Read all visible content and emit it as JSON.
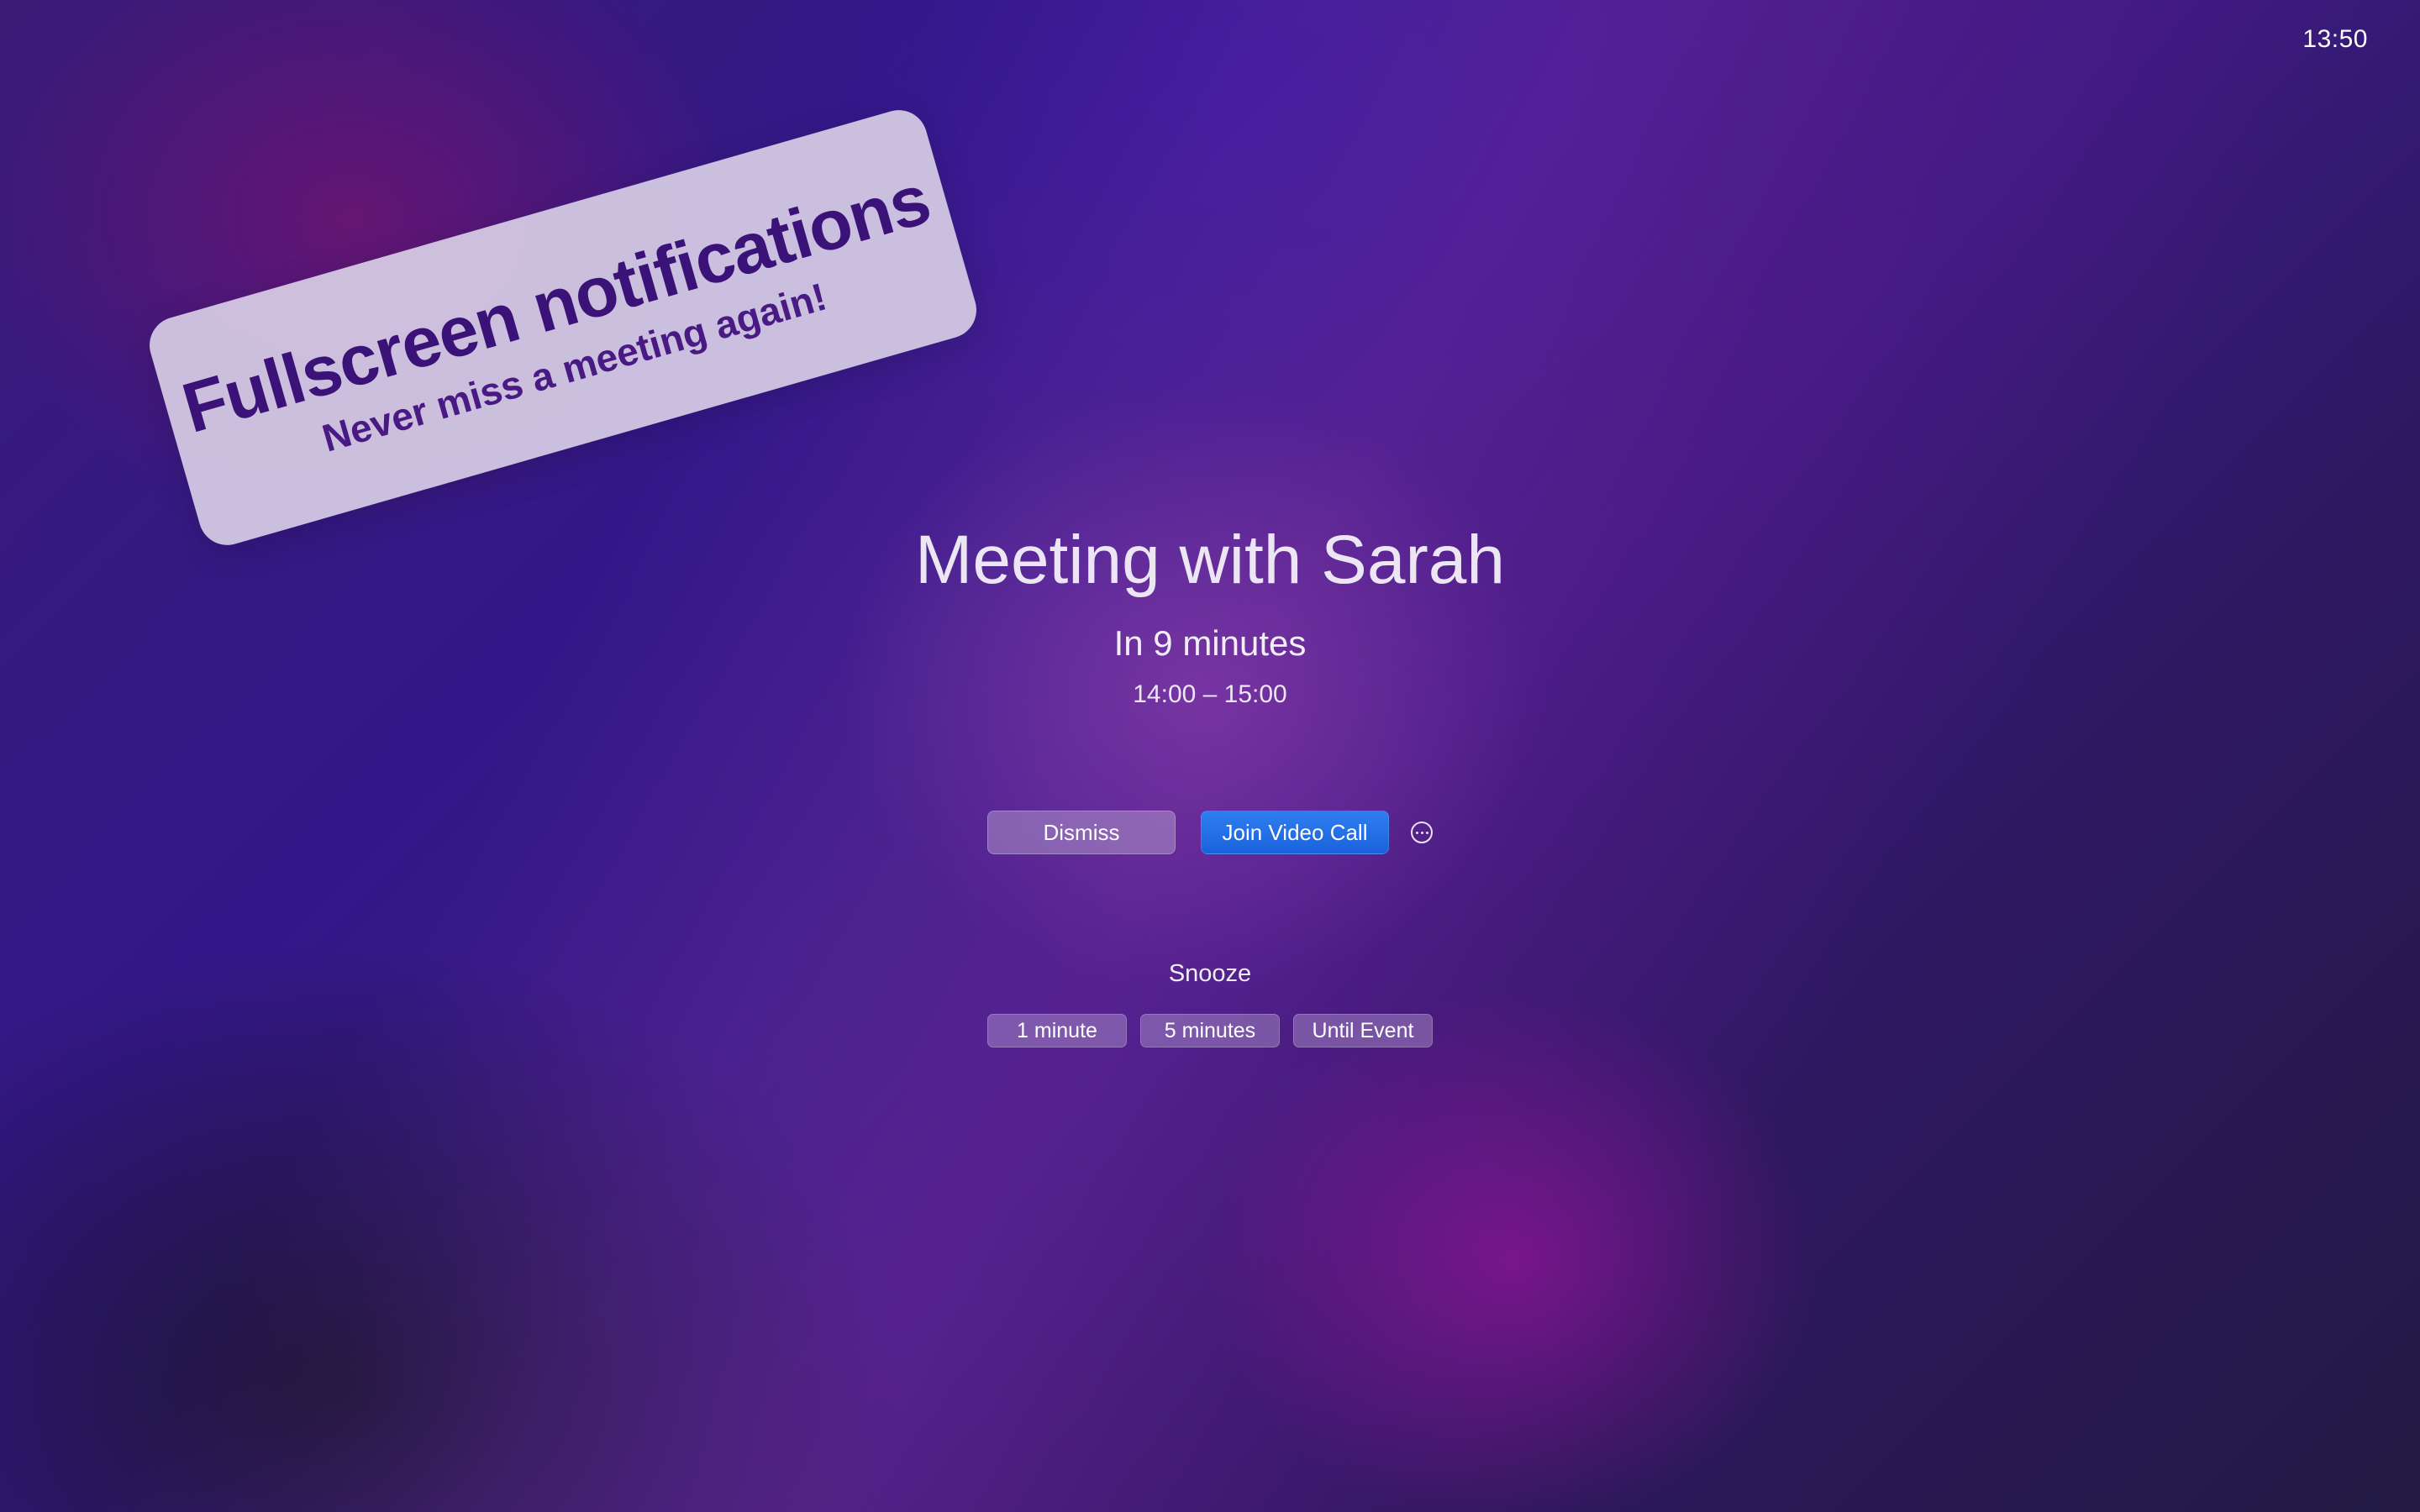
{
  "clock": {
    "time": "13:50"
  },
  "promo": {
    "title": "Fullscreen notifications",
    "subtitle": "Never miss a meeting again!"
  },
  "event": {
    "title": "Meeting with Sarah",
    "countdown": "In 9 minutes",
    "time_range": "14:00 – 15:00"
  },
  "actions": {
    "dismiss_label": "Dismiss",
    "join_label": "Join Video Call",
    "more_icon": "ellipsis-circle-icon"
  },
  "snooze": {
    "label": "Snooze",
    "options": [
      "1 minute",
      "5 minutes",
      "Until Event"
    ]
  },
  "colors": {
    "join_button": "#1a62dc",
    "promo_text": "#3b1278"
  }
}
